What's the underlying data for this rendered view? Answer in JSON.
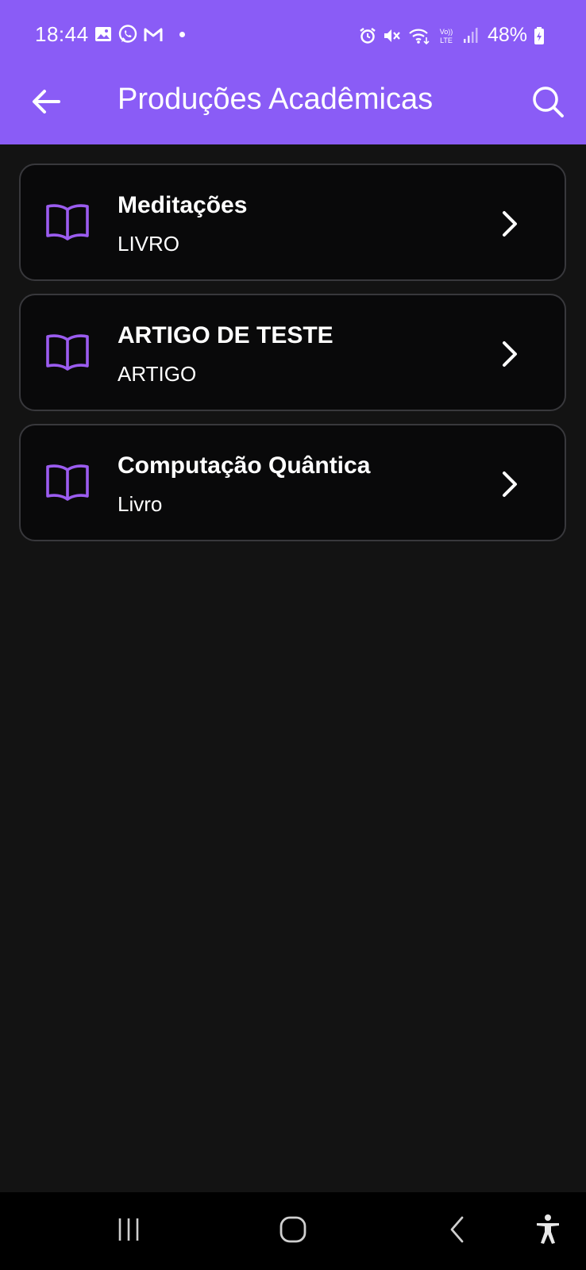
{
  "status_bar": {
    "time": "18:44",
    "battery": "48%",
    "left_icons": [
      "gallery-icon",
      "whatsapp-icon",
      "gmail-icon",
      "notification-dot"
    ],
    "right_icons": [
      "alarm-icon",
      "mute-icon",
      "wifi-icon",
      "volte-icon",
      "signal-icon",
      "battery-icon"
    ]
  },
  "app_bar": {
    "title": "Produções Acadêmicas",
    "back_icon": "arrow-left-icon",
    "search_icon": "search-icon"
  },
  "items": [
    {
      "title": "Meditações",
      "subtitle": "LIVRO",
      "icon": "book-open-icon"
    },
    {
      "title": "ARTIGO DE TESTE",
      "subtitle": "ARTIGO",
      "icon": "book-open-icon"
    },
    {
      "title": "Computação Quântica",
      "subtitle": "Livro",
      "icon": "book-open-icon"
    }
  ],
  "nav_bar": {
    "buttons": [
      "recent-apps-icon",
      "home-icon",
      "back-icon",
      "accessibility-icon"
    ]
  },
  "colors": {
    "accent": "#8a5cf6",
    "background": "#131313",
    "card": "#09090a",
    "card_border": "#38383c",
    "icon": "#9b5cf0"
  }
}
